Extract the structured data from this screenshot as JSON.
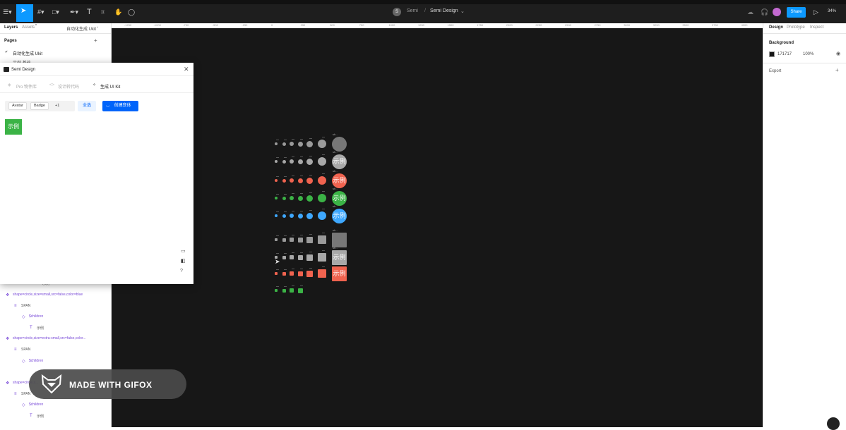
{
  "toolbar": {
    "project_name": "Semi",
    "doc_title": "Semi Design",
    "avatar_letter": "S",
    "share_label": "Share",
    "zoom": "34%"
  },
  "left_panel": {
    "tabs": [
      "Layers",
      "Assets"
    ],
    "page_dropdown": "自动化生成 Ukit",
    "pages_title": "Pages",
    "pages": [
      "自动化生成 Ukit",
      "示例 基础"
    ],
    "layers": [
      {
        "label": "示例",
        "type": "text"
      },
      {
        "label": "shape=circle,size=small,src=false,color=blue",
        "type": "component"
      },
      {
        "label": "SPAN",
        "type": "frame"
      },
      {
        "label": "$children",
        "type": "instance"
      },
      {
        "label": "示例",
        "type": "text"
      },
      {
        "label": "shape=circle,size=extra-small,src=false,color...",
        "type": "component"
      },
      {
        "label": "SPAN",
        "type": "frame"
      },
      {
        "label": "$children",
        "type": "instance"
      },
      {
        "label": "shape=circle,s...",
        "type": "component"
      },
      {
        "label": "SPAN",
        "type": "frame"
      },
      {
        "label": "$children",
        "type": "instance"
      },
      {
        "label": "示例",
        "type": "text"
      }
    ]
  },
  "plugin": {
    "title": "Semi Design",
    "tabs": [
      "Pro 物件库",
      "设计转代码",
      "生成 UI Kit"
    ],
    "active_tab": "生成 UI Kit",
    "chips": [
      "Avatar",
      "Badge"
    ],
    "chip_more": "+1",
    "select_all": "全选",
    "create_button": "创建变体",
    "preview_label": "示例"
  },
  "ruler_top": [
    "-1250",
    "-1000",
    "-750",
    "-500",
    "-250",
    "0",
    "250",
    "500",
    "750",
    "1000",
    "1250",
    "1500",
    "1750",
    "2000",
    "2250",
    "2500",
    "2750",
    "3000",
    "3250",
    "3500",
    "3750",
    "4000"
  ],
  "ruler_left": [
    "-750",
    "1250",
    "1500",
    "1750",
    "2000",
    "2250"
  ],
  "canvas": {
    "frame_label": "sh...",
    "avatar_text": "示例"
  },
  "right_panel": {
    "tabs": [
      "Design",
      "Prototype",
      "Inspect"
    ],
    "background_label": "Background",
    "background_hex": "171717",
    "background_opacity": "100%",
    "export_label": "Export"
  },
  "watermark": "MADE WITH GIFOX",
  "colors": {
    "accent": "#0d99ff",
    "plugin_primary": "#0064fa",
    "canvas_bg": "#171717",
    "green": "#3bb346",
    "red": "#f0634f",
    "blue": "#3ea8ff",
    "grey": "#8e8e8e"
  }
}
